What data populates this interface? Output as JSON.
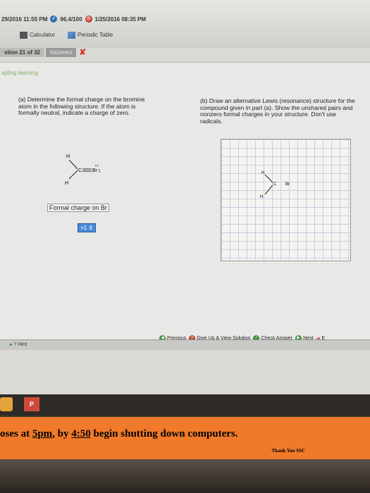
{
  "header": {
    "date_time": "29/2016 11:55 PM",
    "score": "96.4/100",
    "due_date": "1/25/2016 08:35 PM",
    "tools": [
      {
        "label": "Calculator",
        "icon": "calculator-icon"
      },
      {
        "label": "Periodic Table",
        "icon": "periodic-table-icon"
      }
    ],
    "question_tab": "stion 21 of 32",
    "status": "Incorrect"
  },
  "logo": "apling learning",
  "part_a": {
    "prompt": "(a) Determine the formal charge on the bromine atom in the following structure. If the atom is formally neutral, indicate a charge of zero.",
    "formal_charge_label": "Formal charge on Br",
    "answer_value": "+1"
  },
  "part_b": {
    "prompt": "(b) Draw an alternative Lewis (resonance) structure for the compound given in part (a). Show the unshared pairs and nonzero formal charges in your structure. Don't use radicals."
  },
  "molecule": {
    "h_top": "H",
    "h_bottom": "H",
    "carbon": "C",
    "bromine": "Br"
  },
  "nav": {
    "previous": "Previous",
    "give_up": "Give Up & View Solution",
    "check_answer": "Check Answer",
    "next": "Next",
    "exit": "E"
  },
  "hint": "Hint",
  "sign": {
    "prefix": "oses at ",
    "time1": "5pm",
    "mid": ", by ",
    "time2": "4:50",
    "suffix": " begin shutting down computers.",
    "thanks": "Thank You SSC"
  }
}
